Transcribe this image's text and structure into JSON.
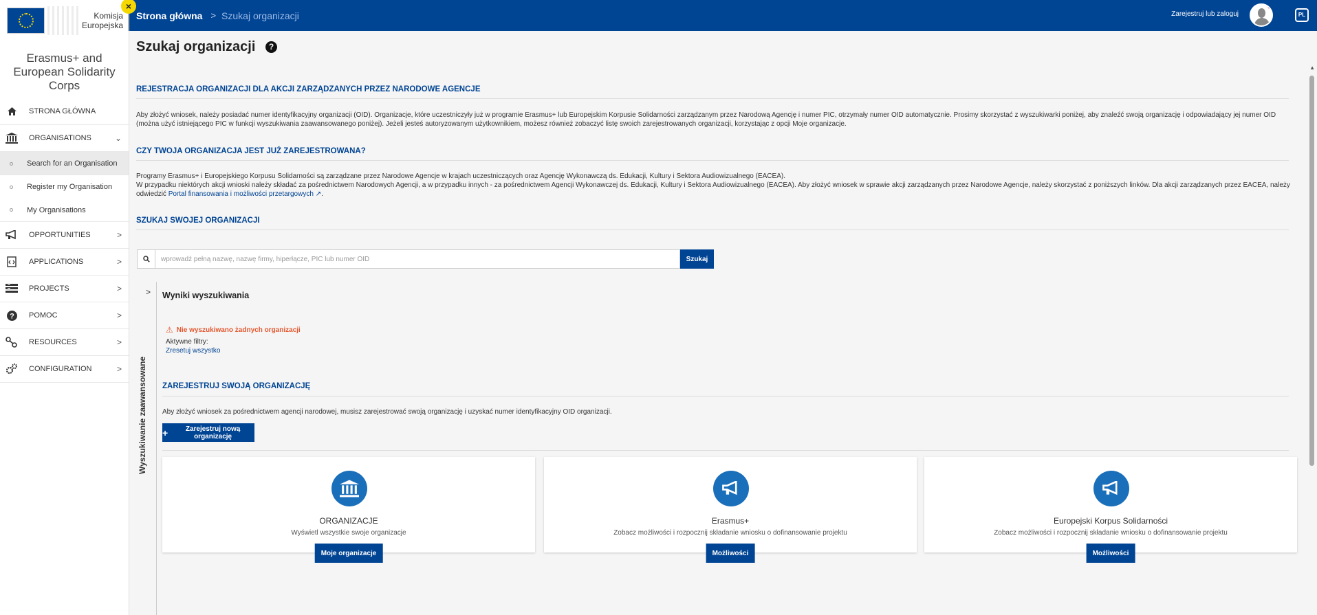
{
  "logo": {
    "line1": "Komisja",
    "line2": "Europejska"
  },
  "close_badge": "×",
  "app_title": "Erasmus+ and European Solidarity Corps",
  "sidebar": {
    "items": [
      {
        "label": "STRONA GŁÓWNA",
        "icon": "home-icon"
      },
      {
        "label": "ORGANISATIONS",
        "icon": "institution-icon"
      },
      {
        "label": "OPPORTUNITIES",
        "icon": "megaphone-icon"
      },
      {
        "label": "APPLICATIONS",
        "icon": "document-code-icon"
      },
      {
        "label": "PROJECTS",
        "icon": "projects-icon"
      },
      {
        "label": "POMOC",
        "icon": "question-icon"
      },
      {
        "label": "RESOURCES",
        "icon": "resources-icon"
      },
      {
        "label": "CONFIGURATION",
        "icon": "gears-icon"
      }
    ],
    "subitems": [
      {
        "label": "Search for an Organisation"
      },
      {
        "label": "Register my Organisation"
      },
      {
        "label": "My Organisations"
      }
    ]
  },
  "topbar": {
    "home": "Strona główna",
    "separator": ">",
    "current": "Szukaj organizacji",
    "login": "Zarejestruj lub zaloguj",
    "lang": "PL"
  },
  "main": {
    "title": "Szukaj organizacji",
    "help": "?",
    "sec1_title": "REJESTRACJA ORGANIZACJI DLA AKCJI ZARZĄDZANYCH PRZEZ NARODOWE AGENCJE",
    "sec1_text": "Aby złożyć wniosek, należy posiadać numer identyfikacyjny organizacji (OID). Organizacje, które uczestniczyły już w programie Erasmus+ lub Europejskim Korpusie Solidarności zarządzanym przez Narodową Agencję i numer PIC, otrzymały numer OID automatycznie. Prosimy skorzystać z wyszukiwarki poniżej, aby znaleźć swoją organizację i odpowiadający jej numer OID (można użyć istniejącego PIC w funkcji wyszukiwania zaawansowanego poniżej). Jeżeli jesteś autoryzowanym użytkownikiem, możesz również zobaczyć listę swoich zarejestrowanych organizacji, korzystając z opcji Moje organizacje.",
    "sec2_title": "CZY TWOJA ORGANIZACJA JEST JUŻ ZAREJESTROWANA?",
    "sec2_text1": "Programy Erasmus+ i Europejskiego Korpusu Solidarności są zarządzane przez Narodowe Agencje w krajach uczestniczących oraz Agencję Wykonawczą ds. Edukacji, Kultury i Sektora Audiowizualnego (EACEA).",
    "sec2_text2": "W przypadku niektórych akcji wnioski należy składać za pośrednictwem Narodowych Agencji, a w przypadku innych - za pośrednictwem Agencji Wykonawczej ds. Edukacji, Kultury i Sektora Audiowizualnego (EACEA). Aby złożyć wniosek w sprawie akcji zarządzanych przez Narodowe Agencje, należy skorzystać z poniższych linków. Dla akcji zarządzanych przez EACEA, należy odwiedzić",
    "sec2_link": "Portal finansowania i możliwości przetargowych",
    "sec3_title": "SZUKAJ SWOJEJ ORGANIZACJI",
    "search_placeholder": "wprowadź pełną nazwę, nazwę firmy, hiperłącze, PIC lub numer OID",
    "search_button": "Szukaj",
    "advanced_label": "Wyszukiwanie zaawansowane",
    "results_title": "Wyniki wyszukiwania",
    "no_results": "Nie wyszukiwano żadnych organizacji",
    "active_filters": "Aktywne filtry:",
    "reset_all": "Zresetuj wszystko",
    "reg_title": "ZAREJESTRUJ SWOJĄ ORGANIZACJĘ",
    "reg_text": "Aby złożyć wniosek za pośrednictwem agencji narodowej, musisz zarejestrować swoją organizację i uzyskać numer identyfikacyjny OID organizacji.",
    "reg_button": "Zarejestruj nową organizację",
    "cards": [
      {
        "title": "ORGANIZACJE",
        "desc": "Wyświetl wszystkie swoje organizacje",
        "button": "Moje organizacje",
        "icon": "institution-icon"
      },
      {
        "title": "Erasmus+",
        "desc": "Zobacz możliwości i rozpocznij składanie wniosku o dofinansowanie projektu",
        "button": "Możliwości",
        "icon": "megaphone-icon"
      },
      {
        "title": "Europejski Korpus Solidarności",
        "desc": "Zobacz możliwości i rozpocznij składanie wniosku o dofinansowanie projektu",
        "button": "Możliwości",
        "icon": "megaphone-icon"
      }
    ]
  },
  "colors": {
    "primary": "#004494",
    "accent_icon": "#1a6fba",
    "warning": "#e4572e",
    "badge": "#f5d800"
  }
}
